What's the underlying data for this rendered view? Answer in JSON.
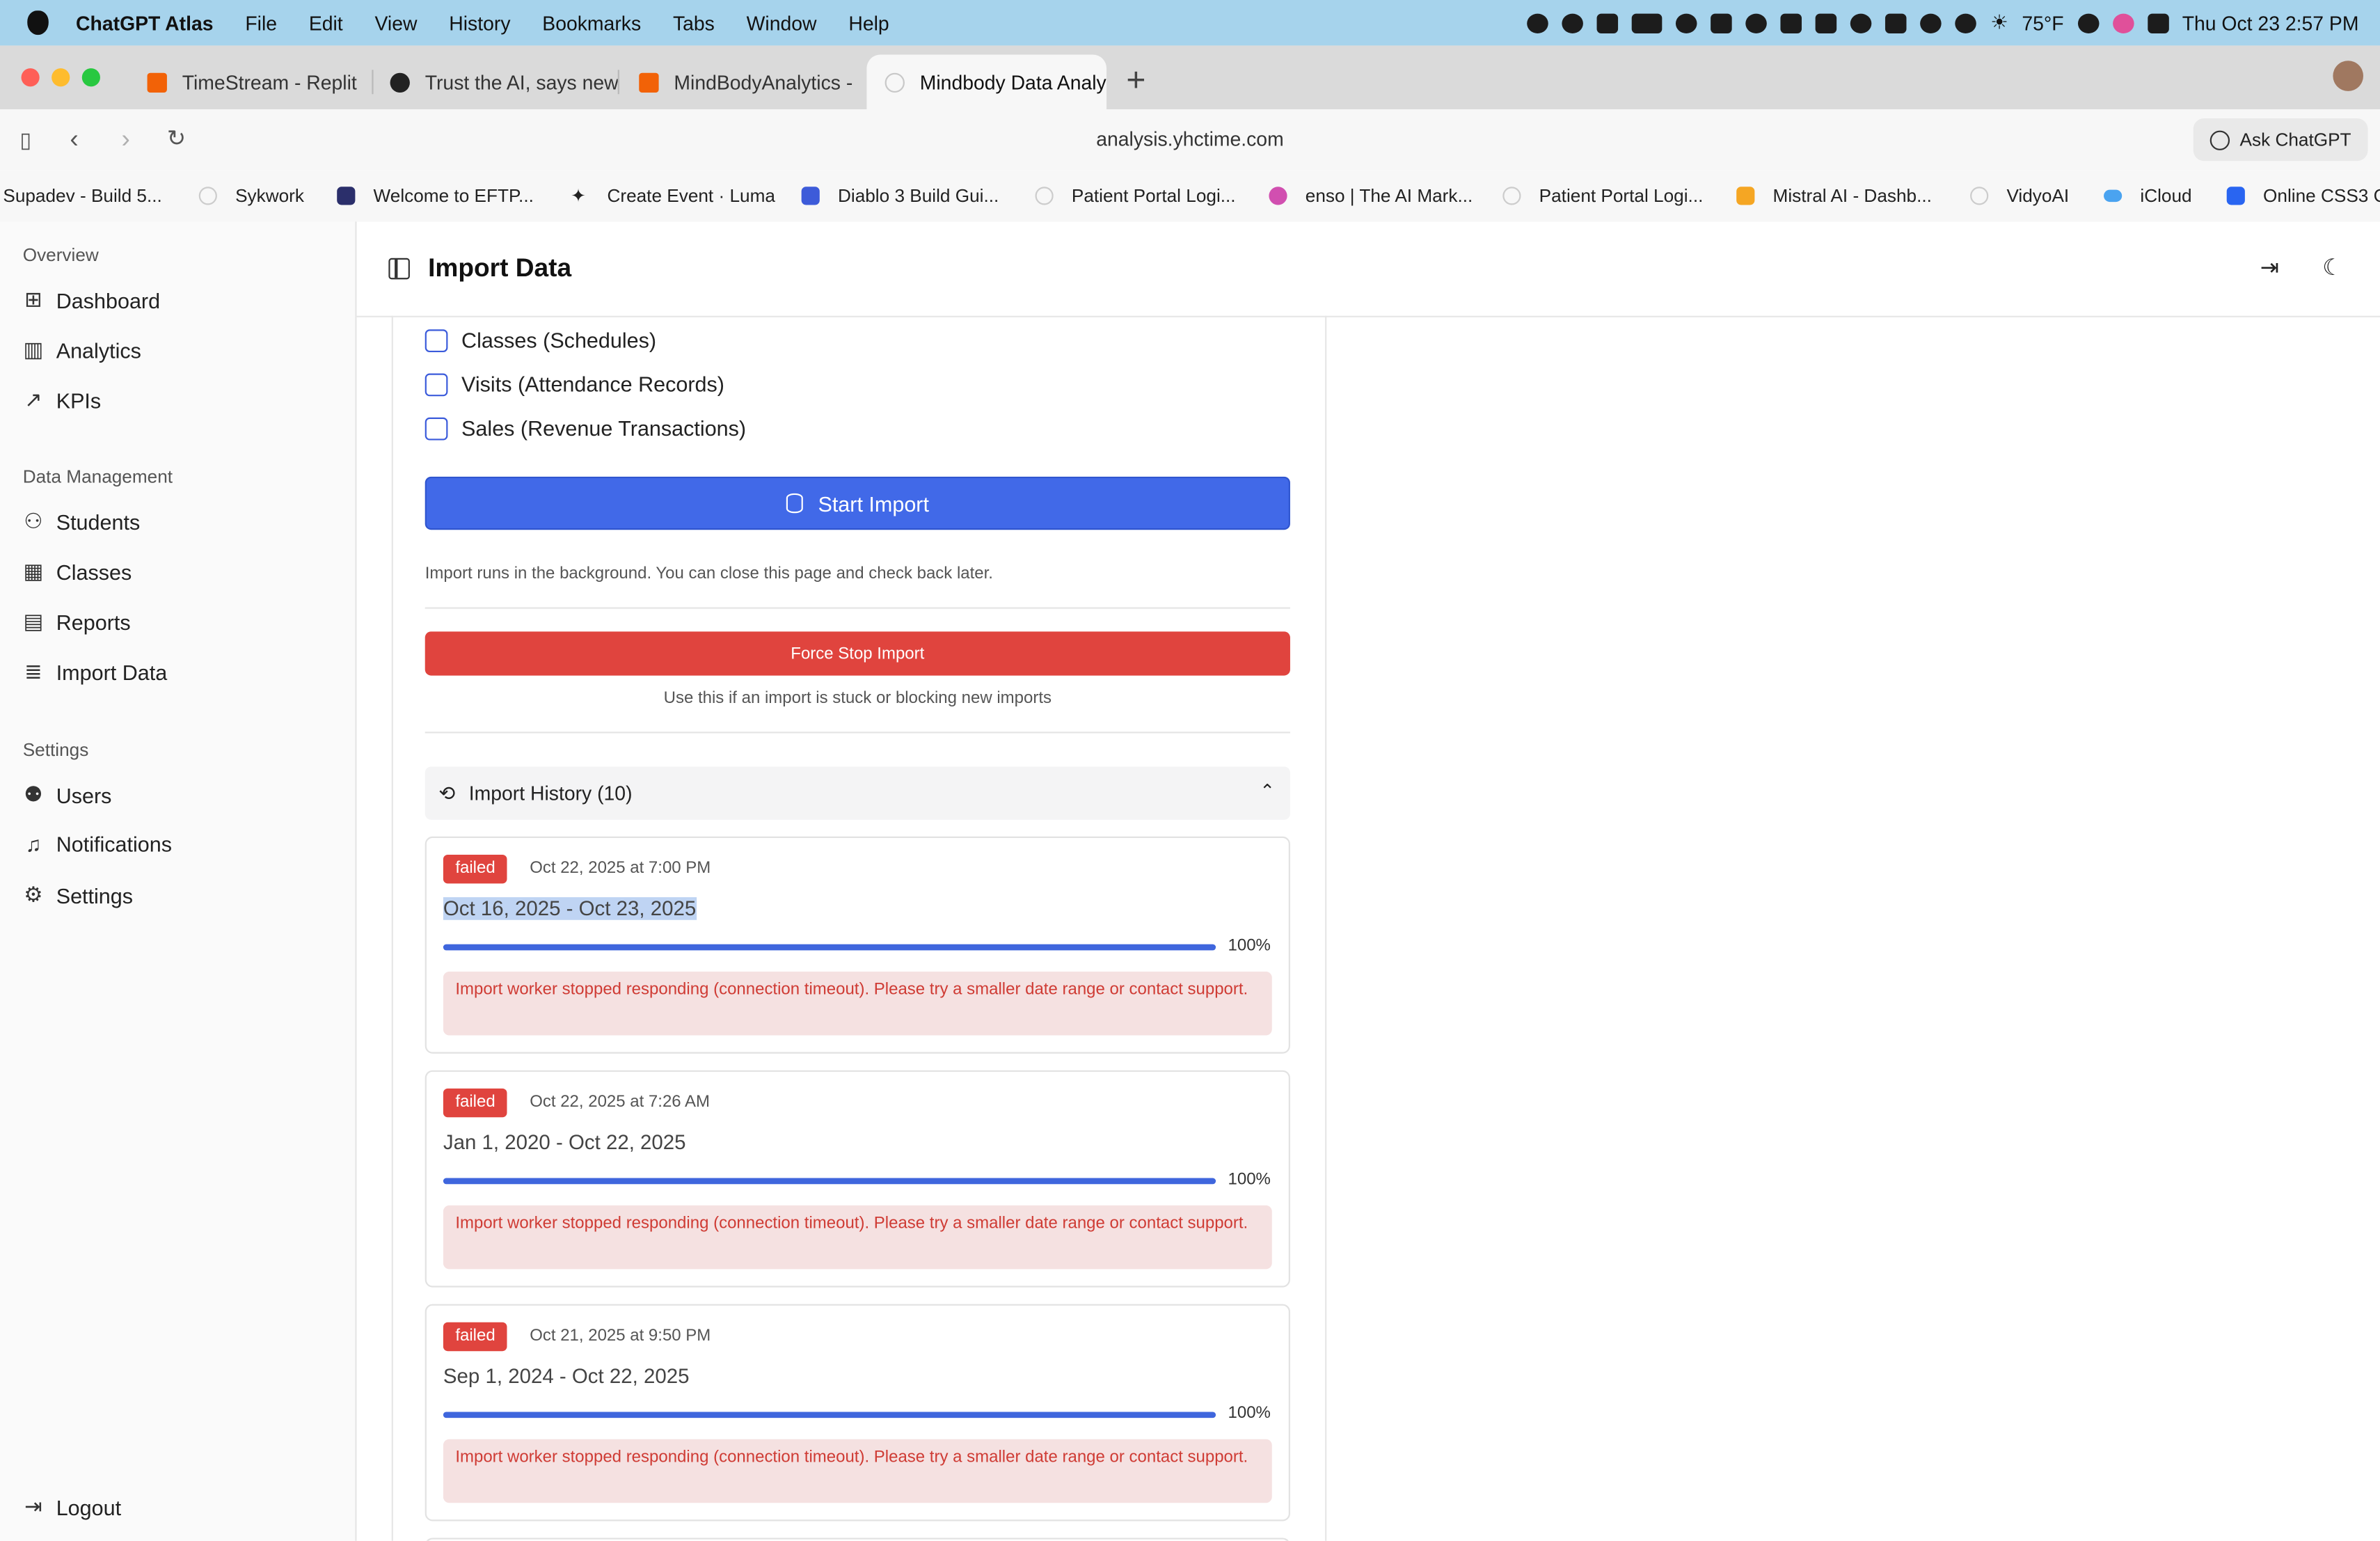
{
  "menubar": {
    "app_name": "ChatGPT Atlas",
    "items": [
      "File",
      "Edit",
      "View",
      "History",
      "Bookmarks",
      "Tabs",
      "Window",
      "Help"
    ],
    "weather": "75°F",
    "clock": "Thu Oct 23   2:57 PM"
  },
  "tabs": [
    {
      "title": "TimeStream - Replit",
      "icon_color": "#f26207"
    },
    {
      "title": "Trust the AI, says new",
      "icon_color": "#222222"
    },
    {
      "title": "MindBodyAnalytics -",
      "icon_color": "#f26207"
    },
    {
      "title": "Mindbody Data Analy",
      "icon_color": "#c8c8c8"
    }
  ],
  "toolbar": {
    "url": "analysis.yhctime.com",
    "ask_label": "Ask ChatGPT"
  },
  "bookmarks": [
    {
      "label": "Supadev - Build 5...",
      "color": ""
    },
    {
      "label": "Sykwork",
      "color": "#d0d0d0"
    },
    {
      "label": "Welcome to EFTP...",
      "color": "#2b2f6b"
    },
    {
      "label": "Create Event · Luma",
      "color": "#111111"
    },
    {
      "label": "Diablo 3 Build Gui...",
      "color": "#3d5bd9"
    },
    {
      "label": "Patient Portal Logi...",
      "color": "#d0d0d0"
    },
    {
      "label": "enso | The AI Mark...",
      "color": "#d14fb0"
    },
    {
      "label": "Patient Portal Logi...",
      "color": "#d0d0d0"
    },
    {
      "label": "Mistral AI - Dashb...",
      "color": "#f5a623"
    },
    {
      "label": "VidyoAI",
      "color": "#d0d0d0"
    },
    {
      "label": "iCloud",
      "color": "#4aa3f0"
    },
    {
      "label": "Online CSS3 C",
      "color": "#2965f1"
    }
  ],
  "sidebar": {
    "overview_title": "Overview",
    "overview": [
      {
        "label": "Dashboard",
        "icon": "dashboard-icon"
      },
      {
        "label": "Analytics",
        "icon": "bar-chart-icon"
      },
      {
        "label": "KPIs",
        "icon": "trend-icon"
      }
    ],
    "data_title": "Data Management",
    "data": [
      {
        "label": "Students",
        "icon": "users-icon"
      },
      {
        "label": "Classes",
        "icon": "calendar-icon"
      },
      {
        "label": "Reports",
        "icon": "file-icon"
      },
      {
        "label": "Import Data",
        "icon": "database-icon"
      }
    ],
    "settings_title": "Settings",
    "settings": [
      {
        "label": "Users",
        "icon": "user-cog-icon"
      },
      {
        "label": "Notifications",
        "icon": "bell-icon"
      },
      {
        "label": "Settings",
        "icon": "gear-icon"
      }
    ],
    "logout": "Logout"
  },
  "page": {
    "title": "Import Data",
    "checkboxes": [
      "Classes (Schedules)",
      "Visits (Attendance Records)",
      "Sales (Revenue Transactions)"
    ],
    "start_import": "Start Import",
    "hint": "Import runs in the background. You can close this page and check back later.",
    "force_stop": "Force Stop Import",
    "force_stop_hint": "Use this if an import is stuck or blocking new imports",
    "history_title": "Import History (10)"
  },
  "history": [
    {
      "status": "failed",
      "date": "Oct 22, 2025 at 7:00 PM",
      "range": "Oct 16, 2025 - Oct 23, 2025",
      "progress": 100,
      "progress_label": "100%",
      "error": "Import worker stopped responding (connection timeout). Please try a smaller date range or contact support."
    },
    {
      "status": "failed",
      "date": "Oct 22, 2025 at 7:26 AM",
      "range": "Jan 1, 2020 - Oct 22, 2025",
      "progress": 100,
      "progress_label": "100%",
      "error": "Import worker stopped responding (connection timeout). Please try a smaller date range or contact support."
    },
    {
      "status": "failed",
      "date": "Oct 21, 2025 at 9:50 PM",
      "range": "Sep 1, 2024 - Oct 22, 2025",
      "progress": 100,
      "progress_label": "100%",
      "error": "Import worker stopped responding (connection timeout). Please try a smaller date range or contact support."
    }
  ],
  "colors": {
    "primary": "#4169e8",
    "danger": "#e0443e",
    "error_bg": "#f5e1e1",
    "selection": "#bfd4f3"
  }
}
